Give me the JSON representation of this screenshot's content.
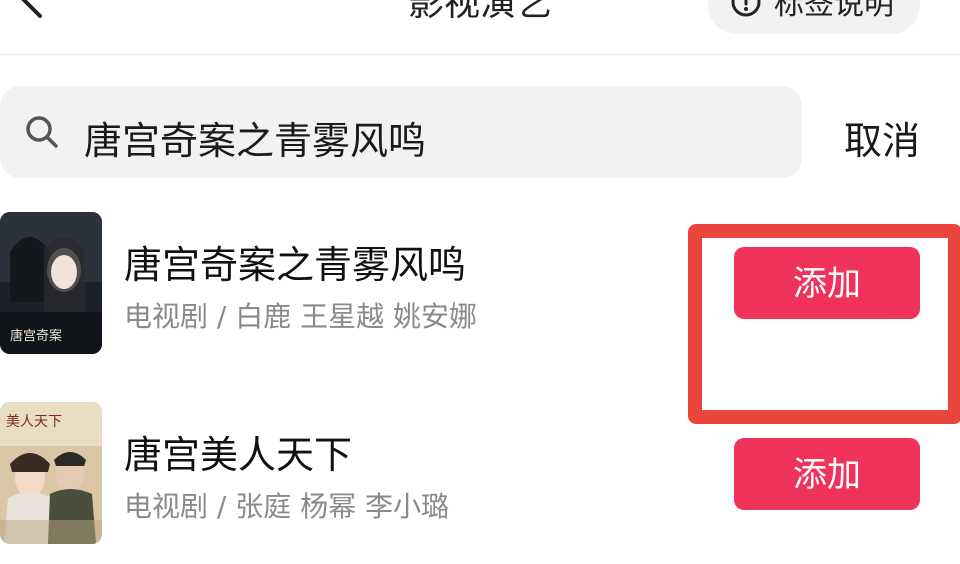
{
  "header": {
    "title": "影视演艺",
    "tag_button_label": "标签说明"
  },
  "search": {
    "value": "唐宫奇案之青雾风鸣",
    "cancel_label": "取消"
  },
  "results": [
    {
      "title": "唐宫奇案之青雾风鸣",
      "meta": "电视剧 / 白鹿 王星越 姚安娜",
      "add_label": "添加",
      "poster_text": "唐宫奇案"
    },
    {
      "title": "唐宫美人天下",
      "meta": "电视剧 / 张庭 杨幂 李小璐",
      "add_label": "添加",
      "poster_text": "美人天下"
    }
  ],
  "colors": {
    "accent": "#f0335b",
    "highlight": "#e8463c"
  }
}
